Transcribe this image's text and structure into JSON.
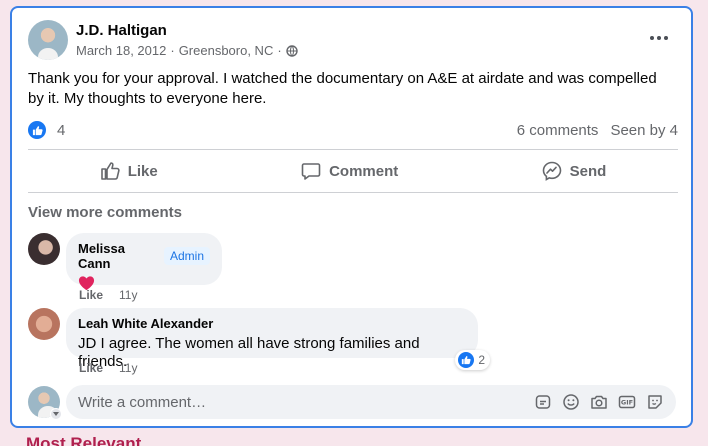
{
  "post": {
    "author": "J.D. Haltigan",
    "date": "March 18, 2012",
    "location": "Greensboro, NC",
    "separator": "·",
    "text": "Thank you for your approval. I watched the documentary on A&E at airdate and was compelled by it. My thoughts to everyone here.",
    "reaction_count": "4",
    "comments_count": "6 comments",
    "seen_by": "Seen by 4"
  },
  "actions": {
    "like": "Like",
    "comment": "Comment",
    "send": "Send"
  },
  "view_more": "View more comments",
  "comments": [
    {
      "name": "Melissa Cann",
      "badge": "Admin",
      "text": "",
      "emoji": "red-heart",
      "like": "Like",
      "age": "11y"
    },
    {
      "name": "Leah White Alexander",
      "text": "JD I agree. The women all have strong families and friends.",
      "reactions": "2",
      "like": "Like",
      "age": "11y"
    }
  ],
  "composer": {
    "placeholder": "Write a comment…",
    "icons": [
      "sticker-icon",
      "emoji-icon",
      "camera-icon",
      "gif-icon",
      "sticker-face-icon"
    ]
  },
  "background_heading": "Most Relevant",
  "colors": {
    "accent": "#1877f2",
    "card_border": "#3a80e6",
    "page_background": "#f7e6ec",
    "heart": "#e0245e"
  }
}
